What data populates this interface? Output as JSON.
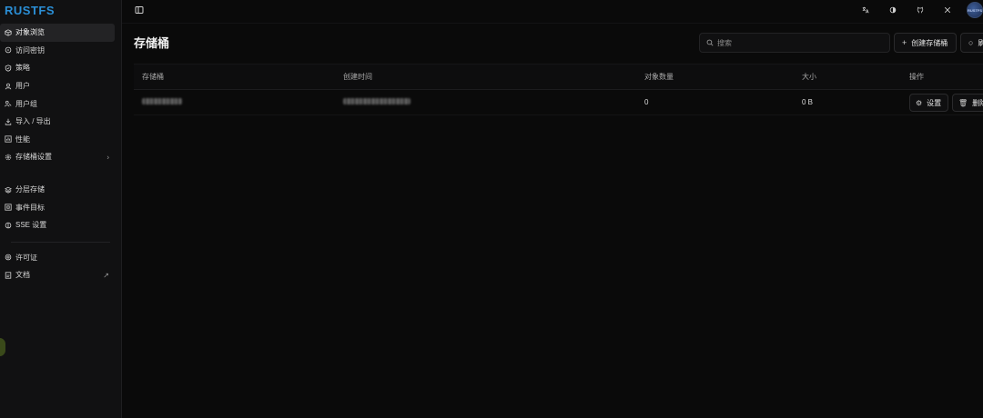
{
  "app": {
    "logo": "RUSTFS"
  },
  "sidebar": {
    "items": [
      {
        "label": "对象浏览",
        "icon": "cube-icon",
        "active": true
      },
      {
        "label": "访问密钥",
        "icon": "key-icon"
      },
      {
        "label": "策略",
        "icon": "shield-icon"
      },
      {
        "label": "用户",
        "icon": "user-icon"
      },
      {
        "label": "用户组",
        "icon": "users-icon"
      },
      {
        "label": "导入 / 导出",
        "icon": "download-icon"
      },
      {
        "label": "性能",
        "icon": "chart-icon"
      },
      {
        "label": "存储桶设置",
        "icon": "settings-icon",
        "trail": "›"
      }
    ],
    "items2": [
      {
        "label": "分层存储",
        "icon": "layers-icon"
      },
      {
        "label": "事件目标",
        "icon": "target-icon"
      },
      {
        "label": "SSE 设置",
        "icon": "lock-icon"
      }
    ],
    "items3": [
      {
        "label": "许可证",
        "icon": "badge-icon"
      },
      {
        "label": "文档",
        "icon": "doc-icon",
        "trail": "↗"
      }
    ]
  },
  "topbar": {
    "icons": [
      "translate-icon",
      "theme-icon",
      "github-icon",
      "x-icon"
    ],
    "avatar_text": "RUSTFS"
  },
  "page": {
    "title": "存储桶",
    "search_placeholder": "搜索",
    "create_label": "创建存储桶",
    "refresh_label": "刷新"
  },
  "table": {
    "headers": [
      "存储桶",
      "创建时间",
      "对象数量",
      "大小",
      "操作"
    ],
    "rows": [
      {
        "objects": "0",
        "size": "0 B",
        "settings_label": "设置",
        "delete_label": "删除"
      }
    ]
  }
}
